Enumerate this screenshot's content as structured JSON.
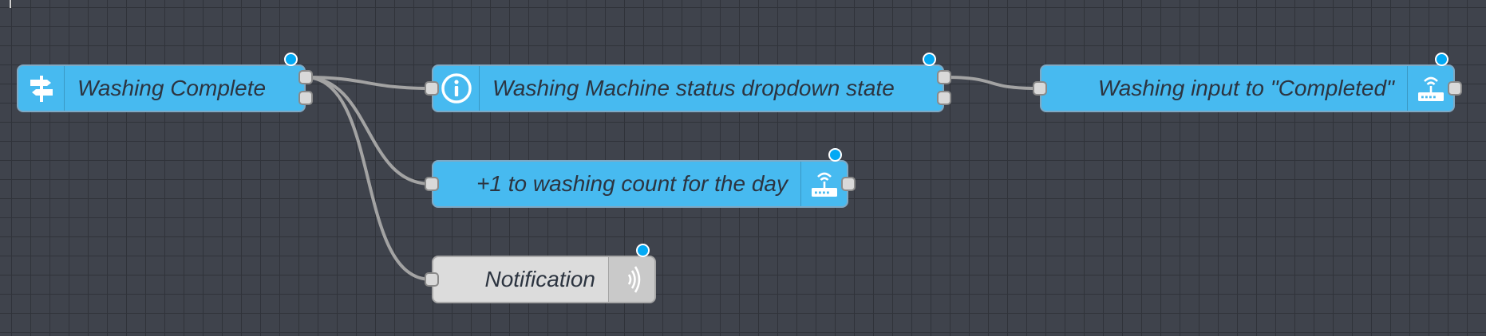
{
  "canvas": {
    "background": "#3f434c",
    "grid_line_color": "#30333a",
    "wire_color": "#a3a3a3"
  },
  "colors": {
    "node_blue": "#47baf0",
    "node_gray": "#dcdcdc",
    "status_blue": "#03a9f4",
    "label_text": "#2c3440"
  },
  "nodes": [
    {
      "id": "washing_complete",
      "label": "Washing Complete",
      "icon": "signpost-icon",
      "type": "state-trigger"
    },
    {
      "id": "status_dropdown",
      "label": "Washing Machine status dropdown state",
      "icon": "info-icon",
      "type": "current-state"
    },
    {
      "id": "washing_input",
      "label": "Washing input to \"Completed\"",
      "icon": "router-icon",
      "type": "call-service"
    },
    {
      "id": "washing_count",
      "label": "+1 to washing count for the day",
      "icon": "router-icon",
      "type": "call-service"
    },
    {
      "id": "notification",
      "label": "Notification",
      "icon": "sound-wave-icon",
      "type": "notify"
    }
  ],
  "wires": [
    {
      "from": "washing_complete",
      "to": "status_dropdown"
    },
    {
      "from": "washing_complete",
      "to": "washing_count"
    },
    {
      "from": "washing_complete",
      "to": "notification"
    },
    {
      "from": "status_dropdown",
      "to": "washing_input"
    }
  ]
}
